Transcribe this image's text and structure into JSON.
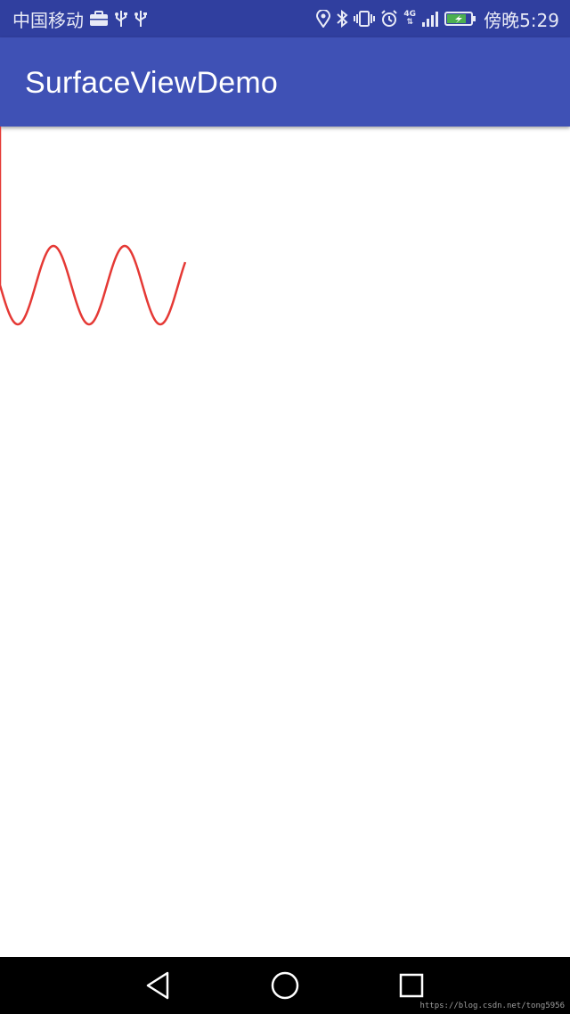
{
  "status_bar": {
    "carrier": "中国移动",
    "network": "4G",
    "time_prefix": "傍晚",
    "time": "5:29",
    "icons": [
      "briefcase-icon",
      "usb-icon",
      "usb-icon",
      "location-icon",
      "bluetooth-icon",
      "vibrate-icon",
      "alarm-icon",
      "signal-icon",
      "battery-charging-icon"
    ]
  },
  "app_bar": {
    "title": "SurfaceViewDemo"
  },
  "canvas": {
    "line_color": "#e53935"
  },
  "nav_bar": {
    "icons": [
      "back-icon",
      "home-icon",
      "recents-icon"
    ]
  },
  "watermark": "https://blog.csdn.net/tong5956",
  "colors": {
    "status_bar": "#303f9f",
    "app_bar": "#3f51b5",
    "nav_bar": "#000000"
  }
}
